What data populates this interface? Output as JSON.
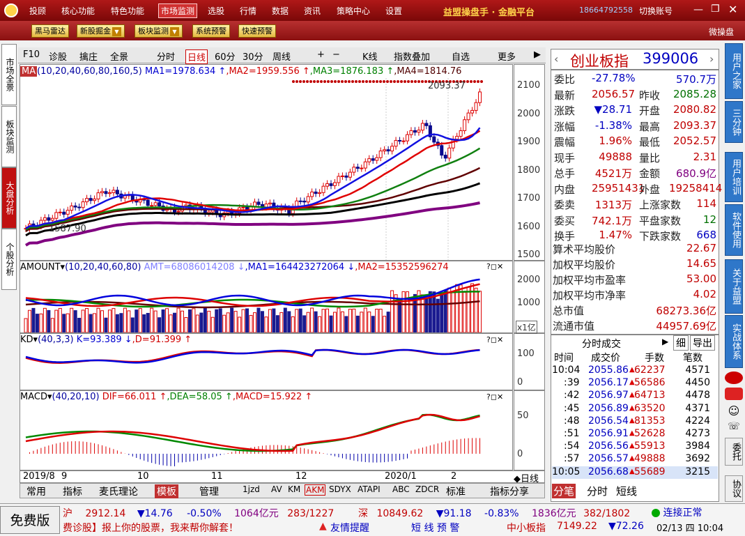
{
  "menubar": {
    "items": [
      "投顾",
      "核心功能",
      "特色功能",
      "市场监测",
      "选股",
      "行情",
      "数据",
      "资讯",
      "策略中心",
      "设置"
    ],
    "active": "市场监测",
    "brand": "益盟操盘手 · 金融平台",
    "phone": "18664792558",
    "switch_account": "切换账号"
  },
  "toolbar": {
    "buttons": [
      "黑马雷达",
      "新股掘金",
      "板块监测",
      "系统预警",
      "快速预警"
    ],
    "right_label": "微操盘"
  },
  "left_tabs": [
    "市场全景",
    "板块监测",
    "大盘分析",
    "个股分析"
  ],
  "right_tabs": [
    "用户之家",
    "三分钟",
    "用户培训",
    "软件使用",
    "关于益盟",
    "实战体系"
  ],
  "right_icons": [
    "委托",
    "协议"
  ],
  "chart_toolbar": {
    "items": [
      "F10",
      "诊股",
      "擒庄",
      "全景",
      "分时",
      "日线",
      "60分",
      "30分",
      "周线",
      "K线",
      "指数叠加",
      "自选",
      "更多"
    ],
    "active": "日线"
  },
  "ma_header": {
    "label": "MA",
    "params": "(10,20,40,60,80,160,5)",
    "ma1": "MA1=1978.634 ↑",
    "ma2": ",MA2=1959.556 ↑",
    "ma3": ",MA3=1876.183 ↑",
    "ma4": ",MA4=1814.76"
  },
  "main_axis": [
    "2100",
    "2000",
    "1900",
    "1800",
    "1700",
    "1600",
    "1500"
  ],
  "main_annotations": {
    "high": "2093.37",
    "low": "1587.90"
  },
  "amount_header": {
    "label": "AMOUNT",
    "params": "(10,20,40,60,80)",
    "amt": "AMT=68086014208 ↓",
    "ma1": ",MA1=164423272064 ↓",
    "ma2": ",MA2=15352596274"
  },
  "amount_axis": [
    "2000",
    "1000",
    "x1亿"
  ],
  "kd_header": {
    "label": "KD",
    "params": "(40,3,3)",
    "k": "K=93.389 ↓",
    "d": ",D=91.399 ↑"
  },
  "kd_axis": [
    "100",
    "0"
  ],
  "macd_header": {
    "label": "MACD",
    "params": "(40,20,10)",
    "dif": "DIF=66.011 ↑",
    "dea": ",DEA=58.05 ↑",
    "macd": ",MACD=15.922 ↑"
  },
  "macd_axis": [
    "50",
    "0"
  ],
  "x_axis": [
    "2019/8",
    "9",
    "10",
    "11",
    "12",
    "2020/1",
    "2"
  ],
  "x_axis_right": "◆日线",
  "bottom_tabs": [
    "常用",
    "指标",
    "麦氏理论",
    "模板",
    "管理",
    "1jzd",
    "AV",
    "KM",
    "AKM",
    "SDYX",
    "ATAPI",
    "ABC",
    "ZDCR",
    "标准",
    "指标分享"
  ],
  "stock": {
    "name": "创业板指",
    "code": "399006"
  },
  "info_top": [
    {
      "l1": "委比",
      "v1": "-27.78%",
      "v2": "570.7万"
    },
    {
      "l1": "最新",
      "v1": "2056.57",
      "l2": "昨收",
      "v2": "2085.28"
    },
    {
      "l1": "涨跌",
      "v1": "▼28.71",
      "l2": "开盘",
      "v2": "2080.82"
    },
    {
      "l1": "涨幅",
      "v1": "-1.38%",
      "l2": "最高",
      "v2": "2093.37"
    },
    {
      "l1": "震幅",
      "v1": "1.96%",
      "l2": "最低",
      "v2": "2052.57"
    },
    {
      "l1": "现手",
      "v1": "49888",
      "l2": "量比",
      "v2": "2.31"
    },
    {
      "l1": "总手",
      "v1": "4521万",
      "l2": "金额",
      "v2": "680.9亿"
    },
    {
      "l1": "内盘",
      "v1": "25951431",
      "l2": "外盘",
      "v2": "19258414"
    },
    {
      "l1": "委卖",
      "v1": "1313万",
      "l2": "上涨家数",
      "v2": "114"
    },
    {
      "l1": "委买",
      "v1": "742.1万",
      "l2": "平盘家数",
      "v2": "12"
    },
    {
      "l1": "换手",
      "v1": "1.47%",
      "l2": "下跌家数",
      "v2": "668"
    }
  ],
  "info_bottom": [
    {
      "l": "算术平均股价",
      "v": "22.67"
    },
    {
      "l": "加权平均股价",
      "v": "14.65"
    },
    {
      "l": "加权平均市盈率",
      "v": "53.00"
    },
    {
      "l": "加权平均市净率",
      "v": "4.02"
    },
    {
      "l": "总市值",
      "v": "68273.36亿"
    },
    {
      "l": "流通市值",
      "v": "44957.69亿"
    }
  ],
  "ticks": {
    "title": "分时成交",
    "buttons": [
      "细",
      "导出"
    ],
    "headers": [
      "时间",
      "成交价",
      "手数",
      "笔数"
    ],
    "rows": [
      [
        "10:04",
        "2055.86",
        "62237",
        "4571"
      ],
      [
        ":39",
        "2056.17",
        "56586",
        "4450"
      ],
      [
        ":42",
        "2056.97",
        "64713",
        "4478"
      ],
      [
        ":45",
        "2056.89",
        "63520",
        "4371"
      ],
      [
        ":48",
        "2056.54",
        "81353",
        "4224"
      ],
      [
        ":51",
        "2056.91",
        "52628",
        "4273"
      ],
      [
        ":54",
        "2056.56",
        "55913",
        "3984"
      ],
      [
        ":57",
        "2056.57",
        "49888",
        "3692"
      ],
      [
        "10:05",
        "2056.68",
        "55689",
        "3215"
      ]
    ],
    "tabs": [
      "分笔",
      "分时",
      "短线"
    ]
  },
  "status": {
    "free": "免费版",
    "sh": [
      "沪",
      "2912.14",
      "▼14.76",
      "-0.50%",
      "1064亿元",
      "283/1227"
    ],
    "sz": [
      "深",
      "10849.62",
      "▼91.18",
      "-0.83%",
      "1836亿元",
      "382/1802"
    ],
    "conn": "连接正常",
    "marquee": "费诊股】报上你的股票，我来帮你解套！",
    "tip": "友情提醒",
    "alert": "短 线 预 警",
    "sme": "中小板指",
    "sme_val": "7149.22",
    "sme_chg": "▼72.26",
    "date": "02/13 四 10:04"
  }
}
